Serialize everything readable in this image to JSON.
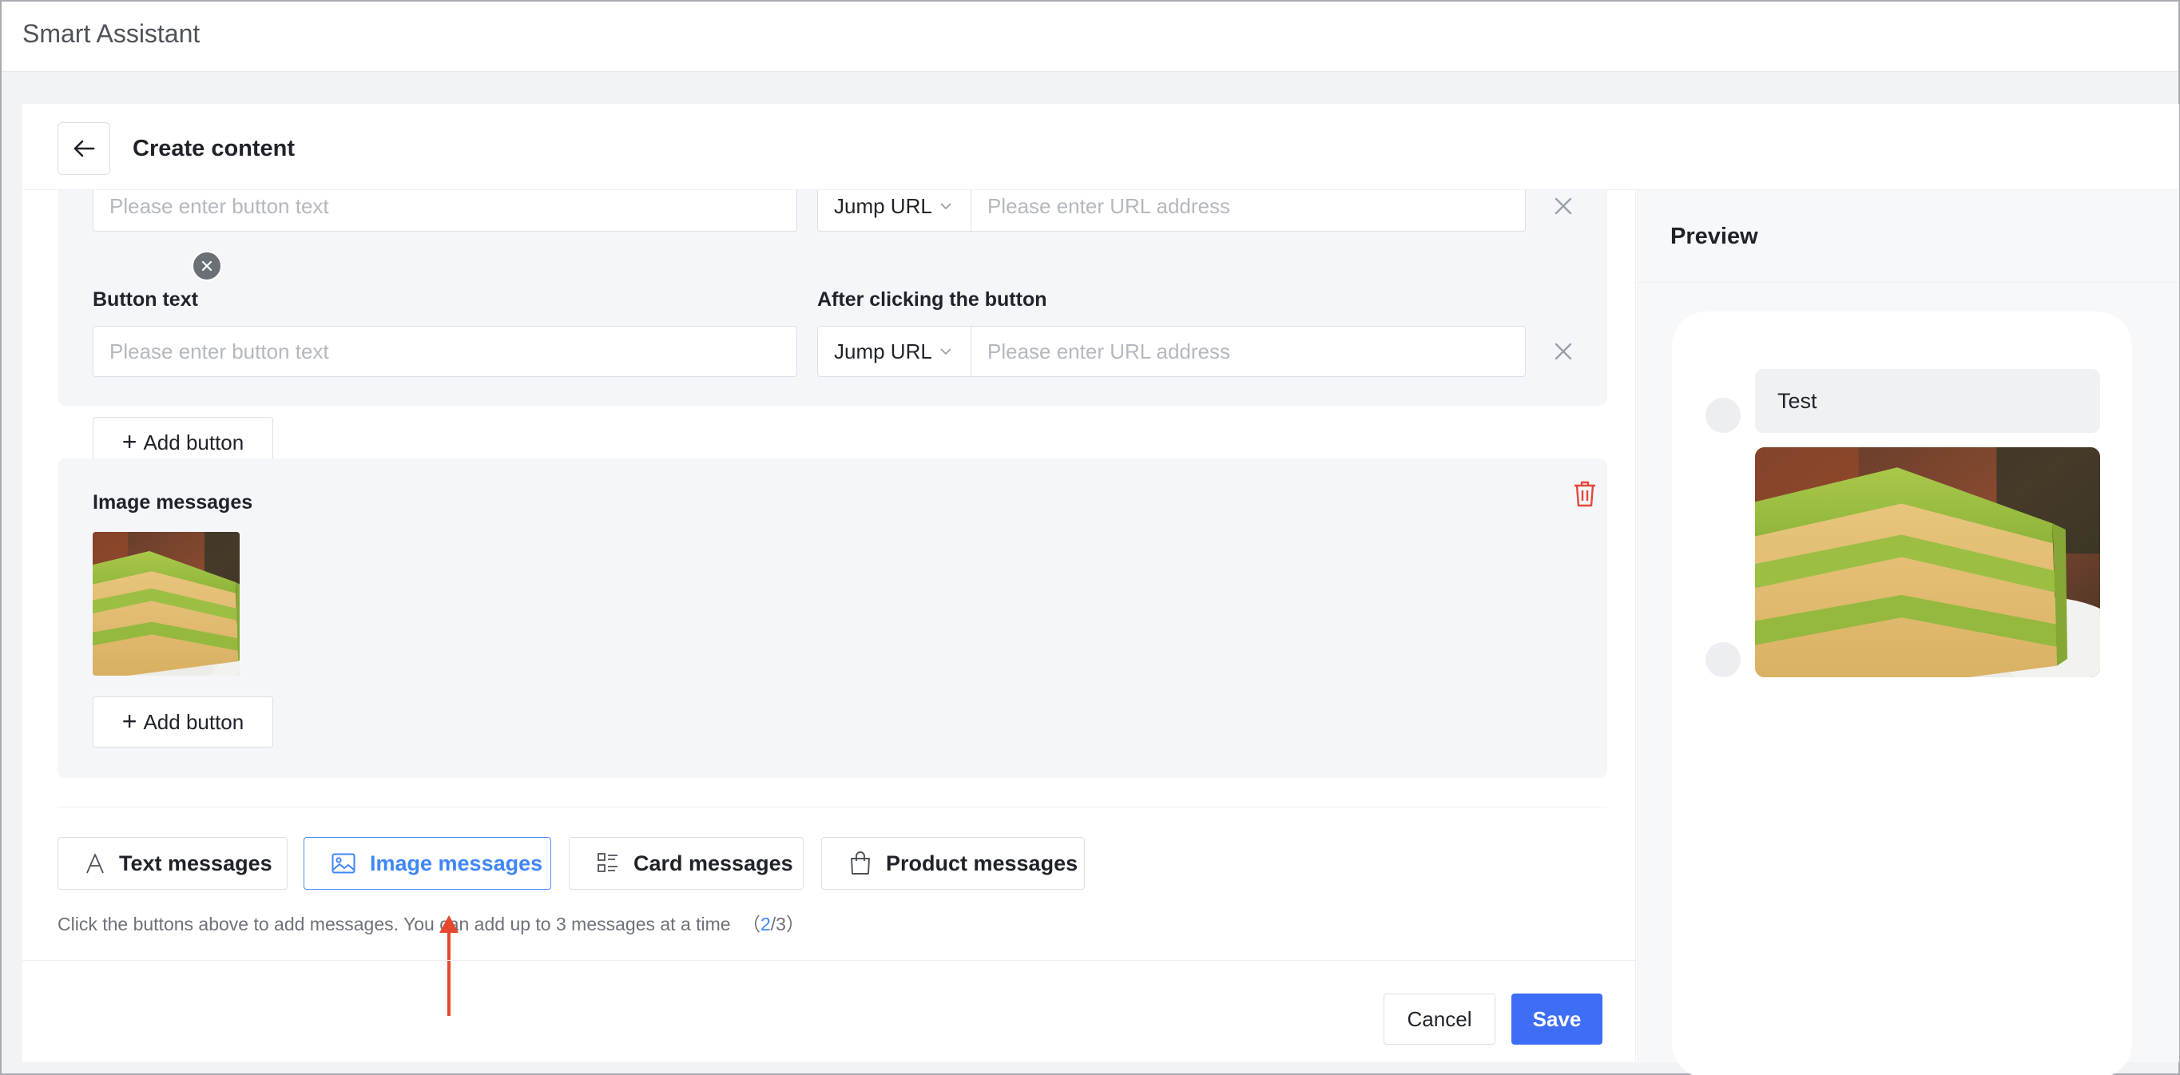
{
  "app": {
    "title": "Smart Assistant"
  },
  "page": {
    "title": "Create content"
  },
  "button_message": {
    "rows": [
      {
        "text_placeholder": "Please enter button text",
        "action": "Jump URL",
        "url_placeholder": "Please enter URL address"
      },
      {
        "text_placeholder": "Please enter button text",
        "action": "Jump URL",
        "url_placeholder": "Please enter URL address"
      }
    ],
    "button_text_label": "Button text",
    "after_click_label": "After clicking the button",
    "add_button_label": "Add button"
  },
  "image_message": {
    "label": "Image messages",
    "add_button_label": "Add button"
  },
  "message_types": [
    {
      "label": "Text messages",
      "icon": "text-icon",
      "active": false
    },
    {
      "label": "Image messages",
      "icon": "image-icon",
      "active": true
    },
    {
      "label": "Card messages",
      "icon": "card-list-icon",
      "active": false
    },
    {
      "label": "Product messages",
      "icon": "shopping-bag-icon",
      "active": false
    }
  ],
  "hint": {
    "text": "Click the buttons above to add messages. You can add up to 3 messages at a time",
    "open": "（",
    "current": "2",
    "separator": "/3",
    "close": "）"
  },
  "footer": {
    "cancel_label": "Cancel",
    "save_label": "Save"
  },
  "preview": {
    "title": "Preview",
    "bubble_text": "Test"
  },
  "colors": {
    "accent": "#3e6ef6",
    "active_blue": "#3f86f6",
    "danger": "#e5483c",
    "annotation_arrow": "#e5482e",
    "card_bg": "#f5f6f9"
  }
}
